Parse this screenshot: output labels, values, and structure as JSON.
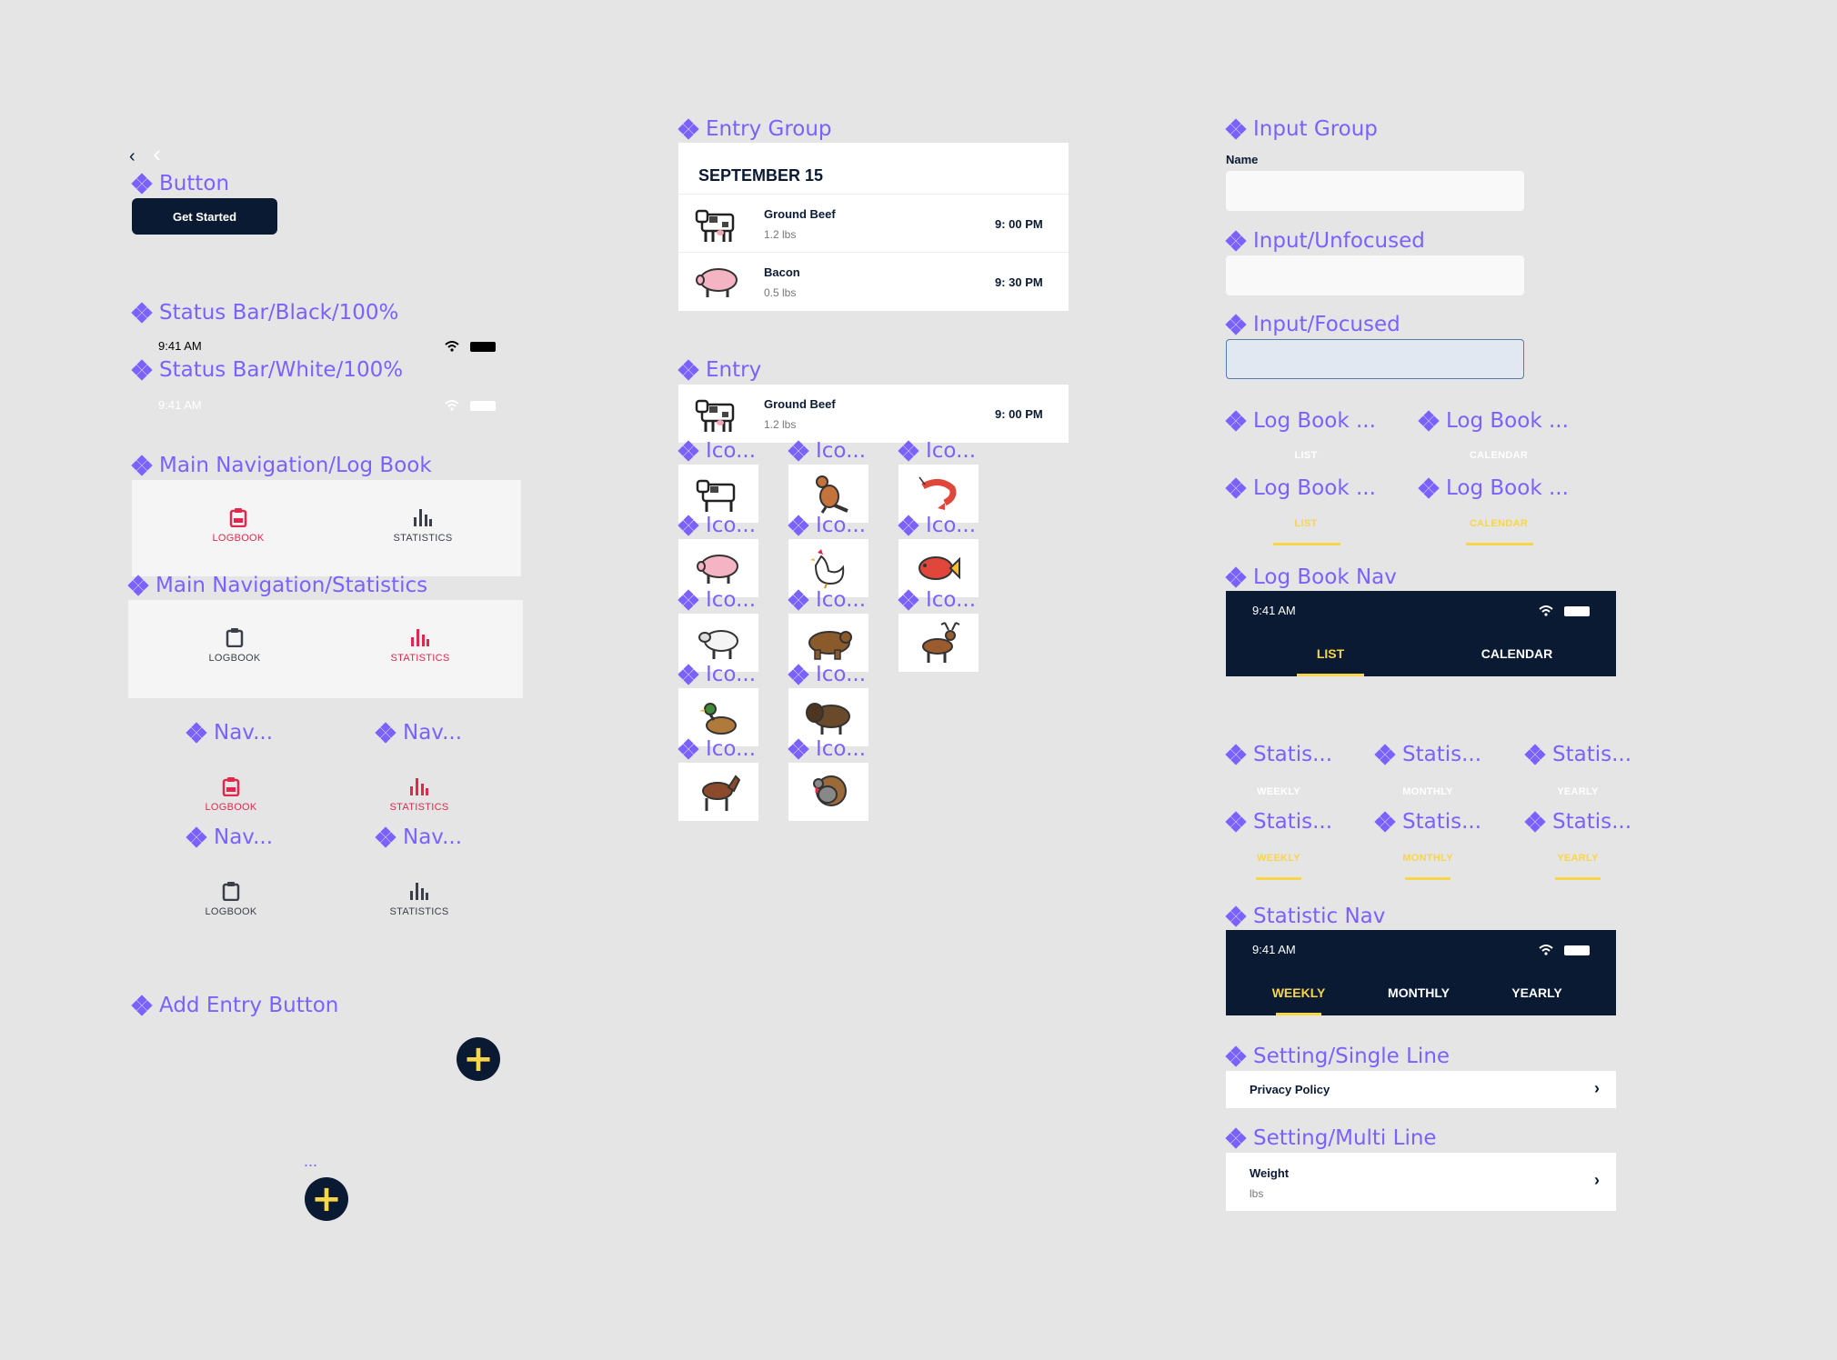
{
  "colors": {
    "accent": "#7b61ff",
    "navy": "#0b1a33",
    "red": "#e0284d",
    "yellow": "#f7d64a",
    "canvas": "#e5e5e5"
  },
  "components": {
    "button": "Button",
    "status_black": "Status Bar/Black/100%",
    "status_white": "Status Bar/White/100%",
    "nav_logbook": "Main Navigation/Log Book",
    "nav_statistics": "Main Navigation/Statistics",
    "nav_short": "Nav...",
    "add_entry": "Add Entry Button",
    "entry_group": "Entry Group",
    "entry": "Entry",
    "icon_short": "Ico...",
    "input_group": "Input Group",
    "input_unfocused": "Input/Unfocused",
    "input_focused": "Input/Focused",
    "logbook_short": "Log Book ...",
    "logbook_nav": "Log Book Nav",
    "statis_short": "Statis...",
    "statistic_nav": "Statistic Nav",
    "setting_single": "Setting/Single Line",
    "setting_multi": "Setting/Multi Line"
  },
  "button": {
    "label": "Get Started"
  },
  "status": {
    "time": "9:41 AM"
  },
  "nav": {
    "logbook": "LOGBOOK",
    "statistics": "STATISTICS"
  },
  "entry_group": {
    "date": "SEPTEMBER 15",
    "entries": [
      {
        "name": "Ground Beef",
        "qty": "1.2 lbs",
        "time": "9: 00 PM",
        "icon": "cow-icon"
      },
      {
        "name": "Bacon",
        "qty": "0.5 lbs",
        "time": "9: 30 PM",
        "icon": "pig-icon"
      }
    ]
  },
  "entry": {
    "name": "Ground Beef",
    "qty": "1.2 lbs",
    "time": "9: 00 PM",
    "icon": "cow-icon"
  },
  "icons": [
    "cow-icon",
    "kangaroo-icon",
    "shrimp-icon",
    "pig-icon",
    "chicken-icon",
    "fish-icon",
    "sheep-icon",
    "bear-icon",
    "deer-icon",
    "duck-icon",
    "bison-icon",
    "horse-icon",
    "turkey-icon"
  ],
  "input": {
    "name_label": "Name"
  },
  "logbook_tabs": {
    "list": "LIST",
    "calendar": "CALENDAR"
  },
  "stat_tabs": {
    "weekly": "WEEKLY",
    "monthly": "MONTHLY",
    "yearly": "YEARLY"
  },
  "settings": {
    "single": {
      "label": "Privacy Policy"
    },
    "multi": {
      "label": "Weight",
      "sub": "lbs"
    }
  },
  "misc": {
    "ellipsis": "..."
  }
}
